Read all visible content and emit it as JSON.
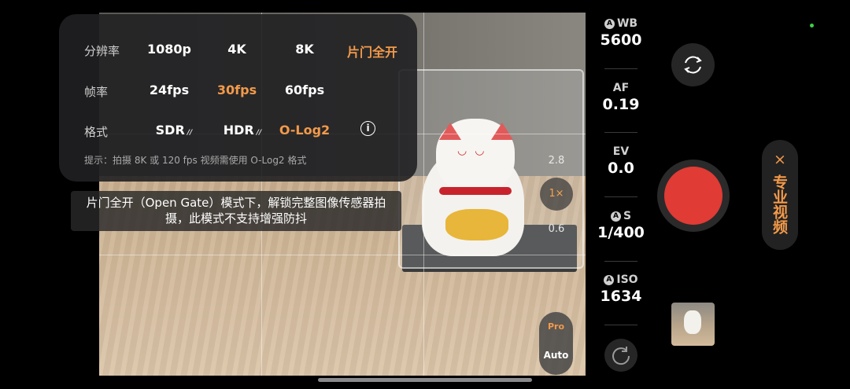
{
  "settings": {
    "resolution": {
      "label": "分辨率",
      "options": [
        "1080p",
        "4K",
        "8K",
        "片门全开"
      ],
      "selected": "片门全开"
    },
    "framerate": {
      "label": "帧率",
      "options": [
        "24fps",
        "30fps",
        "60fps"
      ],
      "selected": "30fps"
    },
    "format": {
      "label": "格式",
      "options": [
        "SDR",
        "HDR",
        "O-Log2"
      ],
      "selected": "O-Log2",
      "info_icon": "info-icon"
    },
    "hint": "提示：拍摄 8K 或 120 fps 视频需使用 O-Log2 格式"
  },
  "tooltip": {
    "line1": "片门全开（Open Gate）模式下，解锁完整图像传感器拍",
    "line2": "摄，此模式不支持增强防抖"
  },
  "zoom": {
    "top": "2.8",
    "current": "1×",
    "bottom": "0.6"
  },
  "mode": {
    "pro": "Pro",
    "auto": "Auto",
    "selected": "Pro"
  },
  "params": {
    "wb": {
      "auto_badge": "A",
      "label": "WB",
      "value": "5600"
    },
    "af": {
      "label": "AF",
      "value": "0.19"
    },
    "ev": {
      "label": "EV",
      "value": "0.0"
    },
    "s": {
      "auto_badge": "A",
      "label": "S",
      "value": "1/400"
    },
    "iso": {
      "auto_badge": "A",
      "label": "ISO",
      "value": "1634"
    }
  },
  "pro_video": {
    "close": "×",
    "label": "专业视频"
  },
  "colors": {
    "accent": "#f39a4a",
    "shutter": "#e03b35",
    "status_dot": "#3ecf4a"
  }
}
